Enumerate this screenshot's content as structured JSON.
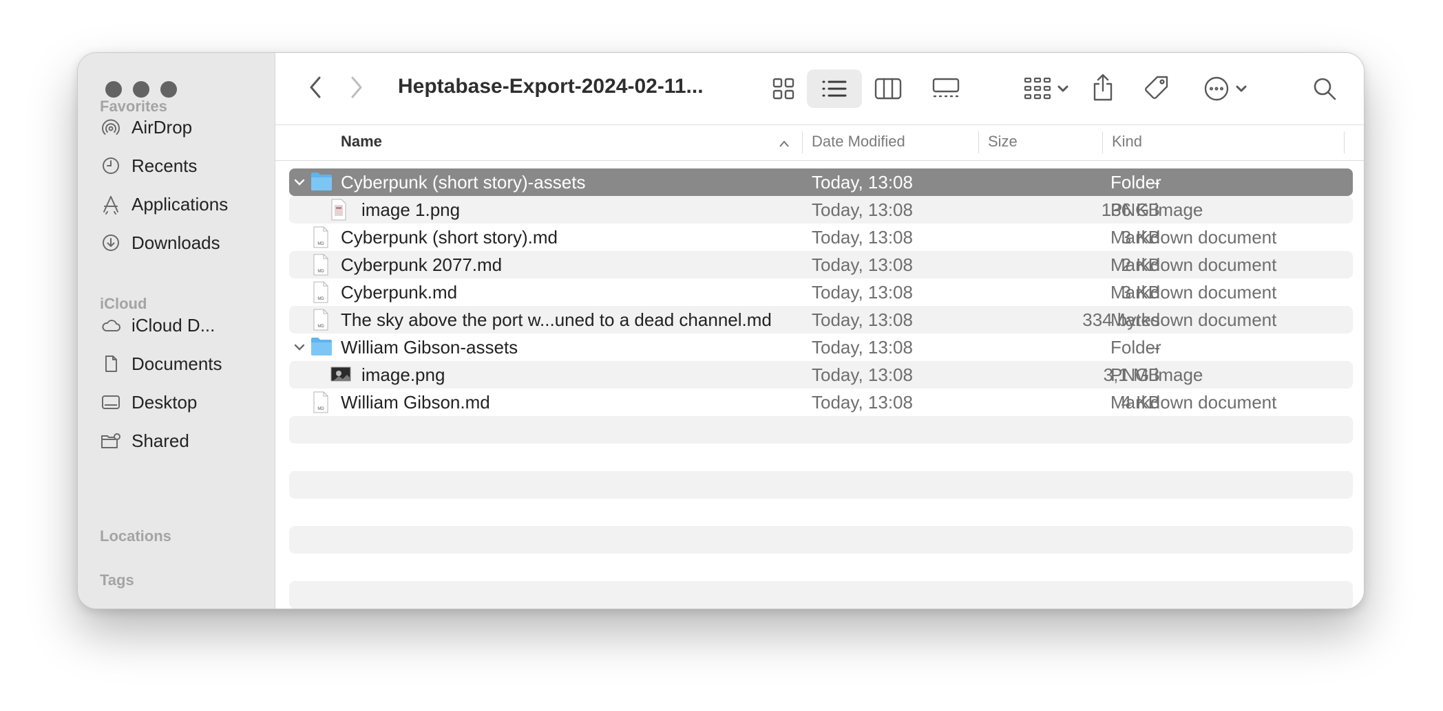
{
  "window": {
    "title": "Heptabase-Export-2024-02-11..."
  },
  "sidebar": {
    "favorites_heading": "Favorites",
    "favorites": [
      {
        "label": "AirDrop",
        "icon": "airdrop-icon"
      },
      {
        "label": "Recents",
        "icon": "clock-icon"
      },
      {
        "label": "Applications",
        "icon": "applications-icon"
      },
      {
        "label": "Downloads",
        "icon": "download-icon"
      }
    ],
    "icloud_heading": "iCloud",
    "icloud": [
      {
        "label": "iCloud D...",
        "icon": "cloud-icon"
      },
      {
        "label": "Documents",
        "icon": "document-icon"
      },
      {
        "label": "Desktop",
        "icon": "desktop-icon"
      },
      {
        "label": "Shared",
        "icon": "shared-folder-icon"
      }
    ],
    "locations_heading": "Locations",
    "tags_heading": "Tags"
  },
  "columns": {
    "name": "Name",
    "date_modified": "Date Modified",
    "size": "Size",
    "kind": "Kind"
  },
  "files": [
    {
      "name": "Cyberpunk (short story)-assets",
      "date": "Today, 13:08",
      "size": "--",
      "kind": "Folder",
      "type": "folder",
      "indent": 0,
      "expanded": true,
      "selected": true
    },
    {
      "name": "image 1.png",
      "date": "Today, 13:08",
      "size": "136 KB",
      "kind": "PNG image",
      "type": "png",
      "indent": 1
    },
    {
      "name": "Cyberpunk (short story).md",
      "date": "Today, 13:08",
      "size": "3 KB",
      "kind": "Markdown document",
      "type": "md",
      "indent": 0
    },
    {
      "name": "Cyberpunk 2077.md",
      "date": "Today, 13:08",
      "size": "2 KB",
      "kind": "Markdown document",
      "type": "md",
      "indent": 0
    },
    {
      "name": "Cyberpunk.md",
      "date": "Today, 13:08",
      "size": "3 KB",
      "kind": "Markdown document",
      "type": "md",
      "indent": 0
    },
    {
      "name": "The sky above the port w...uned to a dead channel.md",
      "date": "Today, 13:08",
      "size": "334 bytes",
      "kind": "Markdown document",
      "type": "md",
      "indent": 0
    },
    {
      "name": "William Gibson-assets",
      "date": "Today, 13:08",
      "size": "--",
      "kind": "Folder",
      "type": "folder",
      "indent": 0,
      "expanded": true
    },
    {
      "name": "image.png",
      "date": "Today, 13:08",
      "size": "3,1 MB",
      "kind": "PNG image",
      "type": "png-photo",
      "indent": 1
    },
    {
      "name": "William Gibson.md",
      "date": "Today, 13:08",
      "size": "4 KB",
      "kind": "Markdown document",
      "type": "md",
      "indent": 0
    }
  ],
  "colors": {
    "selected_row": "#898989",
    "folder_blue": "#5fb4ef",
    "stripe": "#f2f2f2"
  },
  "icons": {
    "md_badge": "MD"
  }
}
